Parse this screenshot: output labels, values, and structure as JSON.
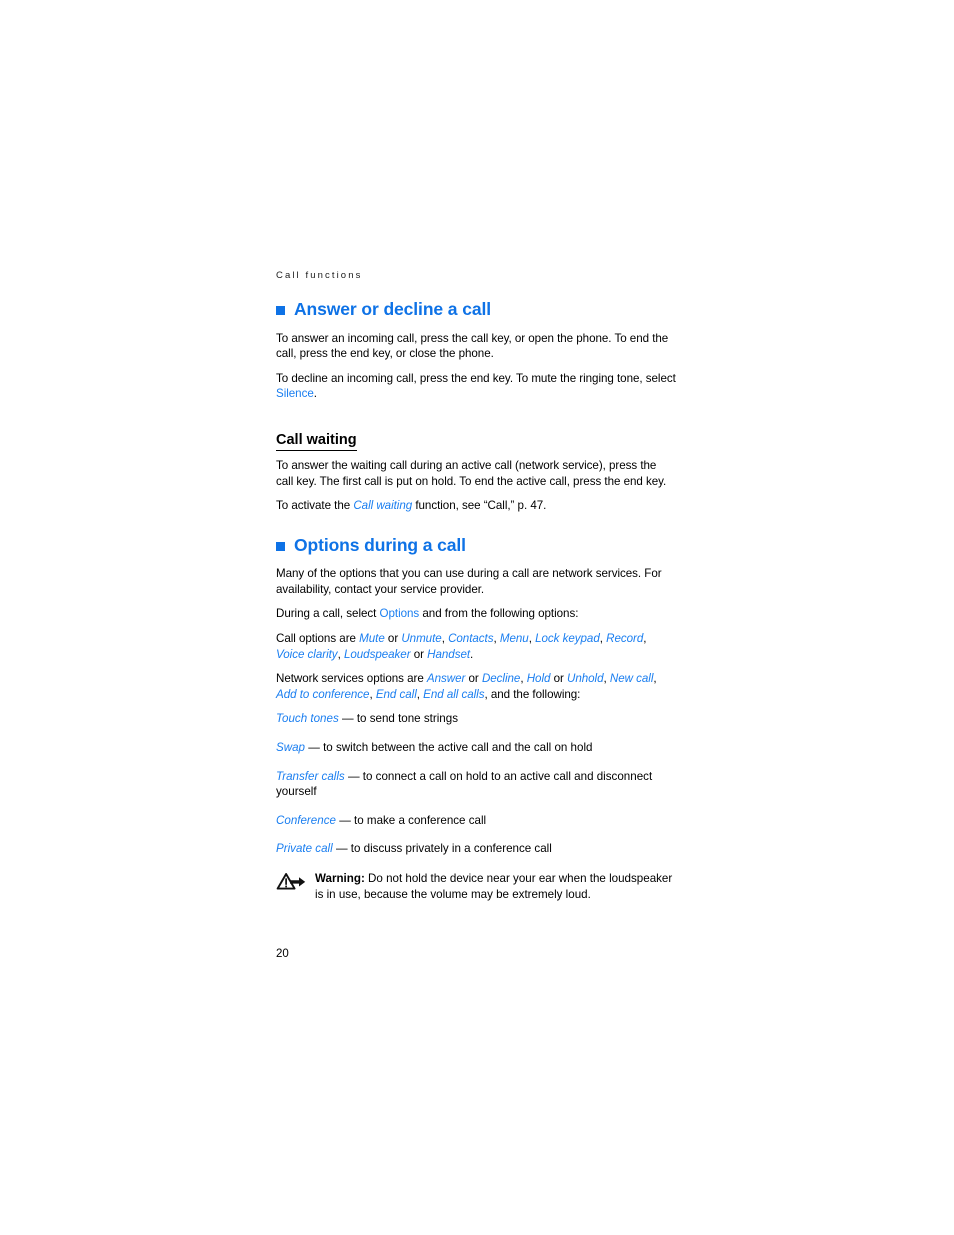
{
  "page": {
    "running_head": "Call functions",
    "page_number": "20",
    "accent_color": "#0e72e6",
    "term_color": "#1a7ef0",
    "text_color": "#000000"
  },
  "sections": [
    {
      "id": "answer-or-decline-a-call",
      "heading": "Answer or decline a call",
      "bullet_icon": "blue-square-bullet",
      "paragraphs": [
        {
          "id": "answer-intro",
          "runs": [
            {
              "text": "To answer an incoming call, press the call key, or open the phone. To end the call, press the end key, or close the phone.",
              "style": "plain"
            }
          ]
        },
        {
          "id": "decline-intro",
          "runs": [
            {
              "text": "To decline an incoming call, press the end key. To mute the ringing tone, select ",
              "style": "plain"
            },
            {
              "text": "Silence",
              "style": "term-upright"
            },
            {
              "text": ".",
              "style": "plain"
            }
          ]
        }
      ],
      "subsection": {
        "id": "call-waiting",
        "heading": "Call waiting",
        "paragraphs": [
          {
            "id": "call-waiting-answer",
            "runs": [
              {
                "text": "To answer the waiting call during an active call (network service), press the call key. The first call is put on hold. To end the active call, press the end key.",
                "style": "plain"
              }
            ]
          },
          {
            "id": "call-waiting-activate",
            "runs": [
              {
                "text": "To activate the ",
                "style": "plain"
              },
              {
                "text": "Call waiting",
                "style": "term-italic"
              },
              {
                "text": " function, see “Call,” p. 47.",
                "style": "plain"
              }
            ]
          }
        ]
      }
    },
    {
      "id": "options-during-a-call",
      "heading": "Options during a call",
      "bullet_icon": "blue-square-bullet",
      "paragraphs": [
        {
          "id": "options-network-services",
          "runs": [
            {
              "text": "Many of the options that you can use during a call are network services. For availability, contact your service provider.",
              "style": "plain"
            }
          ]
        },
        {
          "id": "options-select",
          "runs": [
            {
              "text": "During a call, select ",
              "style": "plain"
            },
            {
              "text": "Options",
              "style": "term-upright"
            },
            {
              "text": " and from the following options:",
              "style": "plain"
            }
          ]
        },
        {
          "id": "call-options-list",
          "runs": [
            {
              "text": "Call options are ",
              "style": "plain"
            },
            {
              "text": "Mute",
              "style": "term-italic"
            },
            {
              "text": " or ",
              "style": "plain"
            },
            {
              "text": "Unmute",
              "style": "term-italic"
            },
            {
              "text": ", ",
              "style": "plain"
            },
            {
              "text": "Contacts",
              "style": "term-italic"
            },
            {
              "text": ", ",
              "style": "plain"
            },
            {
              "text": "Menu",
              "style": "term-italic"
            },
            {
              "text": ", ",
              "style": "plain"
            },
            {
              "text": "Lock keypad",
              "style": "term-italic"
            },
            {
              "text": ", ",
              "style": "plain"
            },
            {
              "text": "Record",
              "style": "term-italic"
            },
            {
              "text": ", ",
              "style": "plain"
            },
            {
              "text": "Voice clarity",
              "style": "term-italic"
            },
            {
              "text": ", ",
              "style": "plain"
            },
            {
              "text": "Loudspeaker",
              "style": "term-italic"
            },
            {
              "text": " or ",
              "style": "plain"
            },
            {
              "text": "Handset",
              "style": "term-italic"
            },
            {
              "text": ".",
              "style": "plain"
            }
          ]
        },
        {
          "id": "network-options-list",
          "runs": [
            {
              "text": "Network services options are ",
              "style": "plain"
            },
            {
              "text": "Answer",
              "style": "term-italic"
            },
            {
              "text": " or ",
              "style": "plain"
            },
            {
              "text": "Decline",
              "style": "term-italic"
            },
            {
              "text": ", ",
              "style": "plain"
            },
            {
              "text": "Hold",
              "style": "term-italic"
            },
            {
              "text": " or ",
              "style": "plain"
            },
            {
              "text": "Unhold",
              "style": "term-italic"
            },
            {
              "text": ", ",
              "style": "plain"
            },
            {
              "text": "New call",
              "style": "term-italic"
            },
            {
              "text": ", ",
              "style": "plain"
            },
            {
              "text": "Add to conference",
              "style": "term-italic"
            },
            {
              "text": ", ",
              "style": "plain"
            },
            {
              "text": "End call",
              "style": "term-italic"
            },
            {
              "text": ", ",
              "style": "plain"
            },
            {
              "text": "End all calls",
              "style": "term-italic"
            },
            {
              "text": ", and the following:",
              "style": "plain"
            }
          ]
        }
      ],
      "definitions": [
        {
          "id": "touch-tones",
          "term": "Touch tones",
          "dash": "—",
          "description": "to send tone strings"
        },
        {
          "id": "swap",
          "term": "Swap",
          "dash": "—",
          "description": "to switch between the active call and the call on hold"
        },
        {
          "id": "transfer-calls",
          "term": "Transfer calls",
          "dash": "—",
          "description": "to connect a call on hold to an active call and disconnect yourself"
        },
        {
          "id": "conference",
          "term": "Conference",
          "dash": "—",
          "description": "to make a conference call"
        },
        {
          "id": "private-call",
          "term": "Private call",
          "dash": "—",
          "description": "to discuss privately in a conference call"
        }
      ],
      "warning": {
        "id": "loudspeaker-warning",
        "icon": "warning-triangle-icon",
        "label": "Warning:",
        "text": " Do not hold the device near your ear when the loudspeaker is in use, because the volume may be extremely loud."
      }
    }
  ]
}
